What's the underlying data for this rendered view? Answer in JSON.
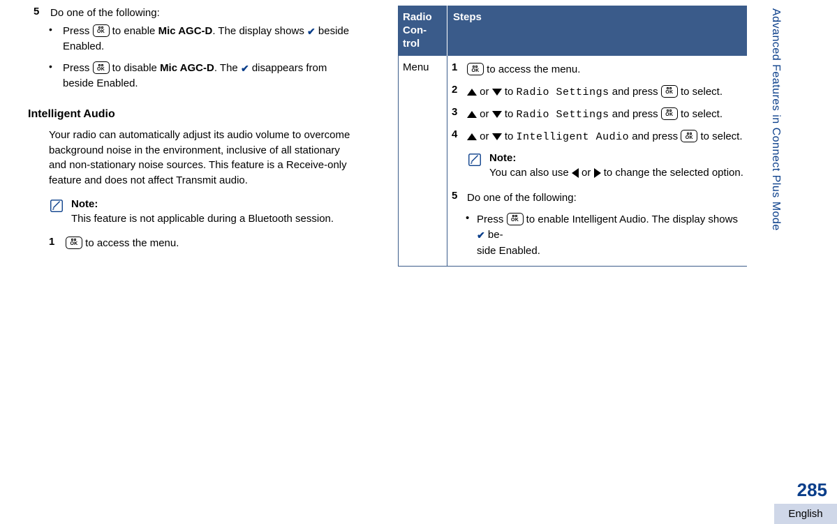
{
  "sidebar_text": "Advanced Features in Connect Plus Mode",
  "left": {
    "step5_num": "5",
    "step5_text": "Do one of the following:",
    "bullet1a": "Press ",
    "bullet1b": " to enable ",
    "bullet1_bold": "Mic AGC-D",
    "bullet1c": ". The display shows ",
    "bullet1d": " beside Enabled.",
    "bullet2a": "Press ",
    "bullet2b": " to disable ",
    "bullet2_bold": "Mic AGC-D",
    "bullet2c": ". The ",
    "bullet2d": " disappears from beside Enabled.",
    "heading": "Intelligent Audio",
    "para": "Your radio can automatically adjust its audio volume to overcome background noise in the environment, inclusive of all stationary and non-stationary noise sources. This feature is a Receive-only feature and does not affect Transmit audio.",
    "note_title": "Note:",
    "note_body": "This feature is not applicable during a Bluetooth session.",
    "step1_num": "1",
    "step1_text": " to access the menu."
  },
  "right": {
    "th1a": "Radio",
    "th1b": "Con-",
    "th1c": "trol",
    "th2": "Steps",
    "td1": "Menu",
    "s1_num": "1",
    "s1_text": " to access the menu.",
    "s2_num": "2",
    "s2_a": " or ",
    "s2_b": " to ",
    "s2_mono": "Radio Settings",
    "s2_c": " and press ",
    "s2_d": " to select.",
    "s3_num": "3",
    "s3_a": " or ",
    "s3_b": " to ",
    "s3_mono": "Radio Settings",
    "s3_c": " and press ",
    "s3_d": " to select.",
    "s4_num": "4",
    "s4_a": " or ",
    "s4_b": " to ",
    "s4_mono": "Intelligent Audio",
    "s4_c": " and press ",
    "s4_d": " to select.",
    "note_title": "Note:",
    "note_a": "You can also use ",
    "note_b": " or ",
    "note_c": " to change the selected option.",
    "s5_num": "5",
    "s5_text": "Do one of the following:",
    "sb1a": "Press ",
    "sb1b": " to enable Intelligent Audio. The display shows ",
    "sb1c": " be-",
    "sb1d": "side Enabled."
  },
  "page_num": "285",
  "lang": "English"
}
